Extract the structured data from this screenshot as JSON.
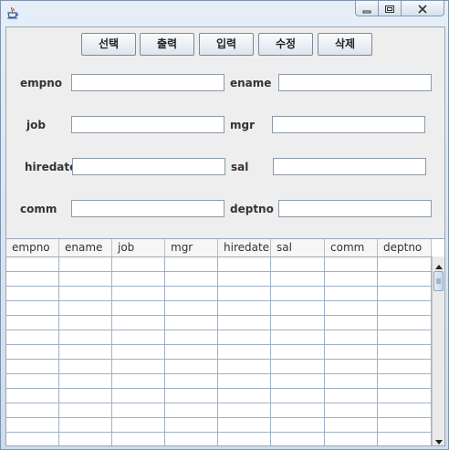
{
  "window": {
    "icon": "java-cup-icon",
    "controls": {
      "minimize": "minimize-icon",
      "maximize": "maximize-icon",
      "close": "close-icon"
    }
  },
  "toolbar": {
    "select_label": "선택",
    "print_label": "출력",
    "insert_label": "입력",
    "update_label": "수정",
    "delete_label": "삭제"
  },
  "form": {
    "empno_label": "empno",
    "ename_label": "ename",
    "job_label": "job",
    "mgr_label": "mgr",
    "hiredate_label": "hiredate",
    "sal_label": "sal",
    "comm_label": "comm",
    "deptno_label": "deptno",
    "empno_value": "",
    "ename_value": "",
    "job_value": "",
    "mgr_value": "",
    "hiredate_value": "",
    "sal_value": "",
    "comm_value": "",
    "deptno_value": ""
  },
  "table": {
    "columns": [
      "empno",
      "ename",
      "job",
      "mgr",
      "hiredate",
      "sal",
      "comm",
      "deptno"
    ],
    "rows": []
  },
  "colors": {
    "window_frame": "#d9e4f1",
    "panel": "#eeeeee",
    "grid_line": "#9fb1c7"
  }
}
